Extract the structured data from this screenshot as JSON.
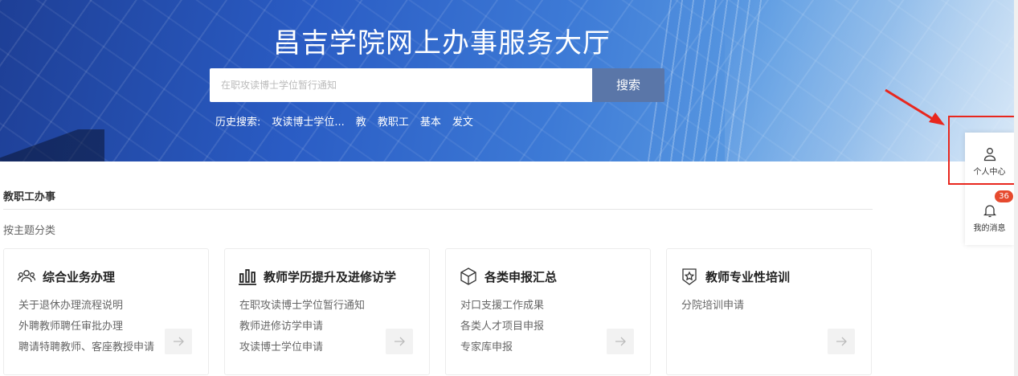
{
  "header": {
    "title": "昌吉学院网上办事服务大厅",
    "search_placeholder": "在职攻读博士学位暂行通知",
    "search_button": "搜索",
    "history_label": "历史搜索:",
    "history_items": [
      "攻读博士学位...",
      "教",
      "教职工",
      "基本",
      "发文"
    ]
  },
  "section": {
    "title": "教职工办事",
    "subtitle": "按主题分类"
  },
  "cards": [
    {
      "icon": "people-group-icon",
      "title": "综合业务办理",
      "links": [
        "关于退休办理流程说明",
        "外聘教师聘任审批办理",
        "聘请特聘教师、客座教授申请"
      ]
    },
    {
      "icon": "bar-columns-icon",
      "title": "教师学历提升及进修访学",
      "links": [
        "在职攻读博士学位暂行通知",
        "教师进修访学申请",
        "攻读博士学位申请"
      ]
    },
    {
      "icon": "cube-icon",
      "title": "各类申报汇总",
      "links": [
        "对口支援工作成果",
        "各类人才项目申报",
        "专家库申报"
      ]
    },
    {
      "icon": "star-badge-icon",
      "title": "教师专业性培训",
      "links": [
        "分院培训申请"
      ]
    }
  ],
  "side": {
    "personal_center": "个人中心",
    "messages": "我的消息",
    "message_count": "36"
  },
  "colors": {
    "search_button": "#5a76a8",
    "badge": "#e64a2e",
    "highlight": "#e8271e"
  }
}
